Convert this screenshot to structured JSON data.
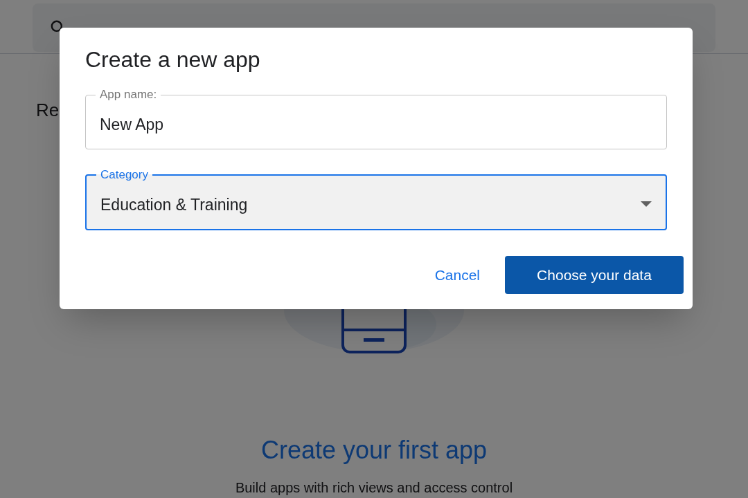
{
  "page": {
    "section_heading": "Re",
    "empty_state": {
      "title": "Create your first app",
      "subtitle": "Build apps with rich views and access control"
    }
  },
  "dialog": {
    "title": "Create a new app",
    "fields": [
      {
        "kind": "text",
        "label": "App name:",
        "value": "New App",
        "focused": false
      },
      {
        "kind": "select",
        "label": "Category",
        "value": "Education & Training",
        "focused": true
      }
    ],
    "buttons": [
      {
        "label": "Cancel",
        "kind": "text"
      },
      {
        "label": "Choose your data",
        "kind": "primary"
      }
    ]
  }
}
